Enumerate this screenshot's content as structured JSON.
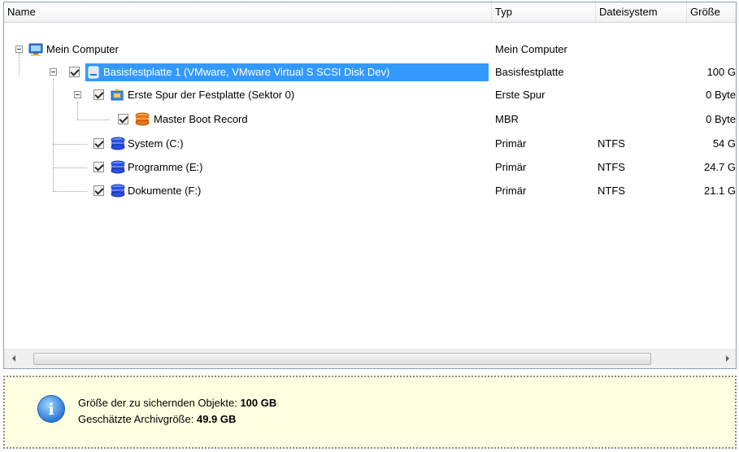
{
  "columns": {
    "name": "Name",
    "type": "Typ",
    "filesystem": "Dateisystem",
    "size": "Größe"
  },
  "rows": [
    {
      "name": "Mein Computer",
      "type": "Mein Computer",
      "filesystem": "",
      "size": "",
      "icon": "computer-icon"
    },
    {
      "name": "Basisfestplatte 1 (VMware, VMware Virtual S SCSI Disk Dev)",
      "type": "Basisfestplatte",
      "filesystem": "",
      "size": "100 G",
      "icon": "hard-disk-icon",
      "checked": true,
      "selected": true
    },
    {
      "name": "Erste Spur der Festplatte (Sektor 0)",
      "type": "Erste Spur",
      "filesystem": "",
      "size": "0 Byte",
      "icon": "track-icon",
      "checked": true
    },
    {
      "name": "Master Boot Record",
      "type": "MBR",
      "filesystem": "",
      "size": "0 Byte",
      "icon": "mbr-icon",
      "checked": true
    },
    {
      "name": "System  (C:)",
      "type": "Primär",
      "filesystem": "NTFS",
      "size": "54 G",
      "icon": "partition-icon",
      "checked": true
    },
    {
      "name": "Programme  (E:)",
      "type": "Primär",
      "filesystem": "NTFS",
      "size": "24.7 G",
      "icon": "partition-icon",
      "checked": true
    },
    {
      "name": "Dokumente  (F:)",
      "type": "Primär",
      "filesystem": "NTFS",
      "size": "21.1 G",
      "icon": "partition-icon",
      "checked": true
    }
  ],
  "info": {
    "size_label": "Größe der zu sichernden Objekte:",
    "size_value": "100 GB",
    "archive_label": "Geschätzte Archivgröße:",
    "archive_value": "49.9 GB"
  },
  "colors": {
    "selection": "#3399ff",
    "info_background": "#ffffe1"
  }
}
